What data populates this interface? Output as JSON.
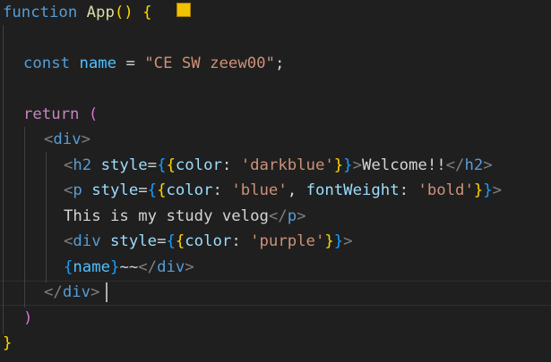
{
  "editor": {
    "theme_colors": {
      "background": "#1f1f1f",
      "keyword": "#569cd6",
      "control": "#c586c0",
      "function": "#dcdcaa",
      "variable": "#9cdcfe",
      "string": "#ce9178",
      "bracket_gold": "#ffd700",
      "bracket_pink": "#da70d6",
      "bracket_blue": "#179fff"
    },
    "lines": [
      {
        "tokens": [
          {
            "text": "function",
            "kind": "kw-blue"
          },
          {
            "text": " ",
            "kind": "text"
          },
          {
            "text": "App",
            "kind": "fn"
          },
          {
            "text": "()",
            "kind": "brace-gold"
          },
          {
            "text": " ",
            "kind": "text"
          },
          {
            "text": "{",
            "kind": "brace-gold"
          }
        ]
      },
      {
        "tokens": []
      },
      {
        "tokens": [
          {
            "text": "const",
            "kind": "kw-blue"
          },
          {
            "text": " ",
            "kind": "text"
          },
          {
            "text": "name",
            "kind": "var-const"
          },
          {
            "text": " = ",
            "kind": "punct"
          },
          {
            "text": "\"CE SW zeew00\"",
            "kind": "str"
          },
          {
            "text": ";",
            "kind": "punct"
          }
        ]
      },
      {
        "tokens": []
      },
      {
        "tokens": [
          {
            "text": "return",
            "kind": "kw-purple"
          },
          {
            "text": " ",
            "kind": "text"
          },
          {
            "text": "(",
            "kind": "brace-pink"
          }
        ]
      },
      {
        "tokens": [
          {
            "text": "<",
            "kind": "tagpunct"
          },
          {
            "text": "div",
            "kind": "tag"
          },
          {
            "text": ">",
            "kind": "tagpunct"
          }
        ]
      },
      {
        "tokens": [
          {
            "text": "<",
            "kind": "tagpunct"
          },
          {
            "text": "h2",
            "kind": "tag"
          },
          {
            "text": " ",
            "kind": "text"
          },
          {
            "text": "style",
            "kind": "attr"
          },
          {
            "text": "=",
            "kind": "punct"
          },
          {
            "text": "{",
            "kind": "brace-blue"
          },
          {
            "text": "{",
            "kind": "brace-gold"
          },
          {
            "text": "color",
            "kind": "attr"
          },
          {
            "text": ": ",
            "kind": "punct"
          },
          {
            "text": "'darkblue'",
            "kind": "str"
          },
          {
            "text": "}",
            "kind": "brace-gold"
          },
          {
            "text": "}",
            "kind": "brace-blue"
          },
          {
            "text": ">",
            "kind": "tagpunct"
          },
          {
            "text": "Welcome!!",
            "kind": "text"
          },
          {
            "text": "</",
            "kind": "tagpunct"
          },
          {
            "text": "h2",
            "kind": "tag"
          },
          {
            "text": ">",
            "kind": "tagpunct"
          }
        ]
      },
      {
        "tokens": [
          {
            "text": "<",
            "kind": "tagpunct"
          },
          {
            "text": "p",
            "kind": "tag"
          },
          {
            "text": " ",
            "kind": "text"
          },
          {
            "text": "style",
            "kind": "attr"
          },
          {
            "text": "=",
            "kind": "punct"
          },
          {
            "text": "{",
            "kind": "brace-blue"
          },
          {
            "text": "{",
            "kind": "brace-gold"
          },
          {
            "text": "color",
            "kind": "attr"
          },
          {
            "text": ": ",
            "kind": "punct"
          },
          {
            "text": "'blue'",
            "kind": "str"
          },
          {
            "text": ", ",
            "kind": "punct"
          },
          {
            "text": "fontWeight",
            "kind": "attr"
          },
          {
            "text": ": ",
            "kind": "punct"
          },
          {
            "text": "'bold'",
            "kind": "str"
          },
          {
            "text": "}",
            "kind": "brace-gold"
          },
          {
            "text": "}",
            "kind": "brace-blue"
          },
          {
            "text": ">",
            "kind": "tagpunct"
          }
        ]
      },
      {
        "tokens": [
          {
            "text": "This is my study velog",
            "kind": "text"
          },
          {
            "text": "</",
            "kind": "tagpunct"
          },
          {
            "text": "p",
            "kind": "tag"
          },
          {
            "text": ">",
            "kind": "tagpunct"
          }
        ]
      },
      {
        "tokens": [
          {
            "text": "<",
            "kind": "tagpunct"
          },
          {
            "text": "div",
            "kind": "tag"
          },
          {
            "text": " ",
            "kind": "text"
          },
          {
            "text": "style",
            "kind": "attr"
          },
          {
            "text": "=",
            "kind": "punct"
          },
          {
            "text": "{",
            "kind": "brace-blue"
          },
          {
            "text": "{",
            "kind": "brace-gold"
          },
          {
            "text": "color",
            "kind": "attr"
          },
          {
            "text": ": ",
            "kind": "punct"
          },
          {
            "text": "'purple'",
            "kind": "str"
          },
          {
            "text": "}",
            "kind": "brace-gold"
          },
          {
            "text": "}",
            "kind": "brace-blue"
          },
          {
            "text": ">",
            "kind": "tagpunct"
          }
        ]
      },
      {
        "tokens": [
          {
            "text": "{",
            "kind": "brace-blue"
          },
          {
            "text": "name",
            "kind": "var-const"
          },
          {
            "text": "}",
            "kind": "brace-blue"
          },
          {
            "text": "~~",
            "kind": "text"
          },
          {
            "text": "</",
            "kind": "tagpunct"
          },
          {
            "text": "div",
            "kind": "tag"
          },
          {
            "text": ">",
            "kind": "tagpunct"
          }
        ]
      },
      {
        "tokens": [
          {
            "text": "</",
            "kind": "tagpunct"
          },
          {
            "text": "div",
            "kind": "tag"
          },
          {
            "text": ">",
            "kind": "tagpunct"
          }
        ]
      },
      {
        "tokens": [
          {
            "text": ")",
            "kind": "brace-pink"
          }
        ]
      },
      {
        "tokens": [
          {
            "text": "}",
            "kind": "brace-gold"
          }
        ]
      }
    ]
  }
}
